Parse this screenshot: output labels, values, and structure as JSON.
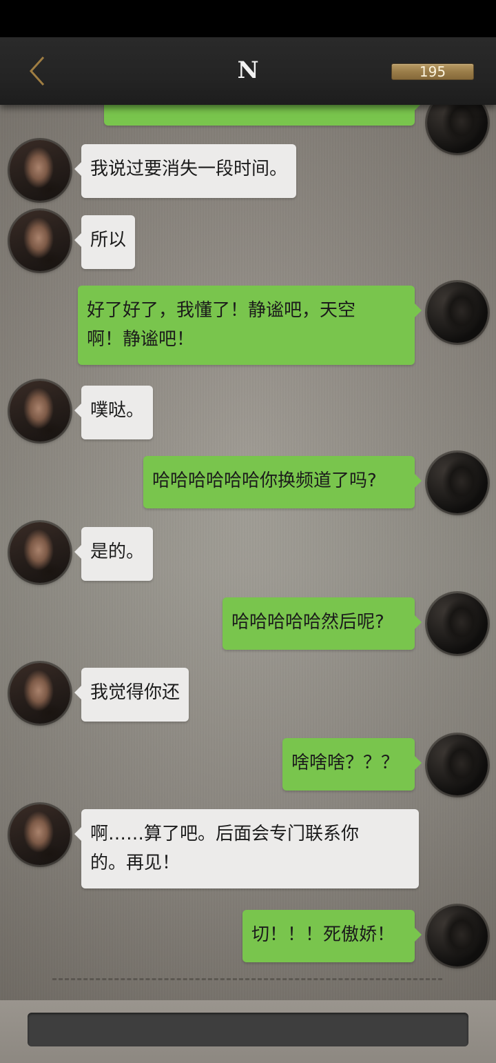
{
  "header": {
    "title": "N",
    "coins": "195",
    "back_icon": "chevron-left-icon"
  },
  "colors": {
    "header_bg": "#242424",
    "player_bubble": "#79c54d",
    "npc_bubble": "#ecebea",
    "coin_gold": "#9a7d49"
  },
  "messages": [
    {
      "from": "player",
      "text": ""
    },
    {
      "from": "npc",
      "text": "我说过要消失一段时间。"
    },
    {
      "from": "npc",
      "text": "所以"
    },
    {
      "from": "player",
      "text": "好了好了，我懂了！静谧吧，天空\n啊！静谧吧！"
    },
    {
      "from": "npc",
      "text": "噗哒。"
    },
    {
      "from": "player",
      "text": "哈哈哈哈哈哈你换频道了吗?"
    },
    {
      "from": "npc",
      "text": "是的。"
    },
    {
      "from": "player",
      "text": "哈哈哈哈哈然后呢?"
    },
    {
      "from": "npc",
      "text": "我觉得你还"
    },
    {
      "from": "player",
      "text": "啥啥啥？？？"
    },
    {
      "from": "npc",
      "text": "啊……算了吧。后面会专门联系你\n的。再见！"
    },
    {
      "from": "player",
      "text": "切！！！死傲娇！"
    }
  ],
  "input": {
    "placeholder": ""
  }
}
